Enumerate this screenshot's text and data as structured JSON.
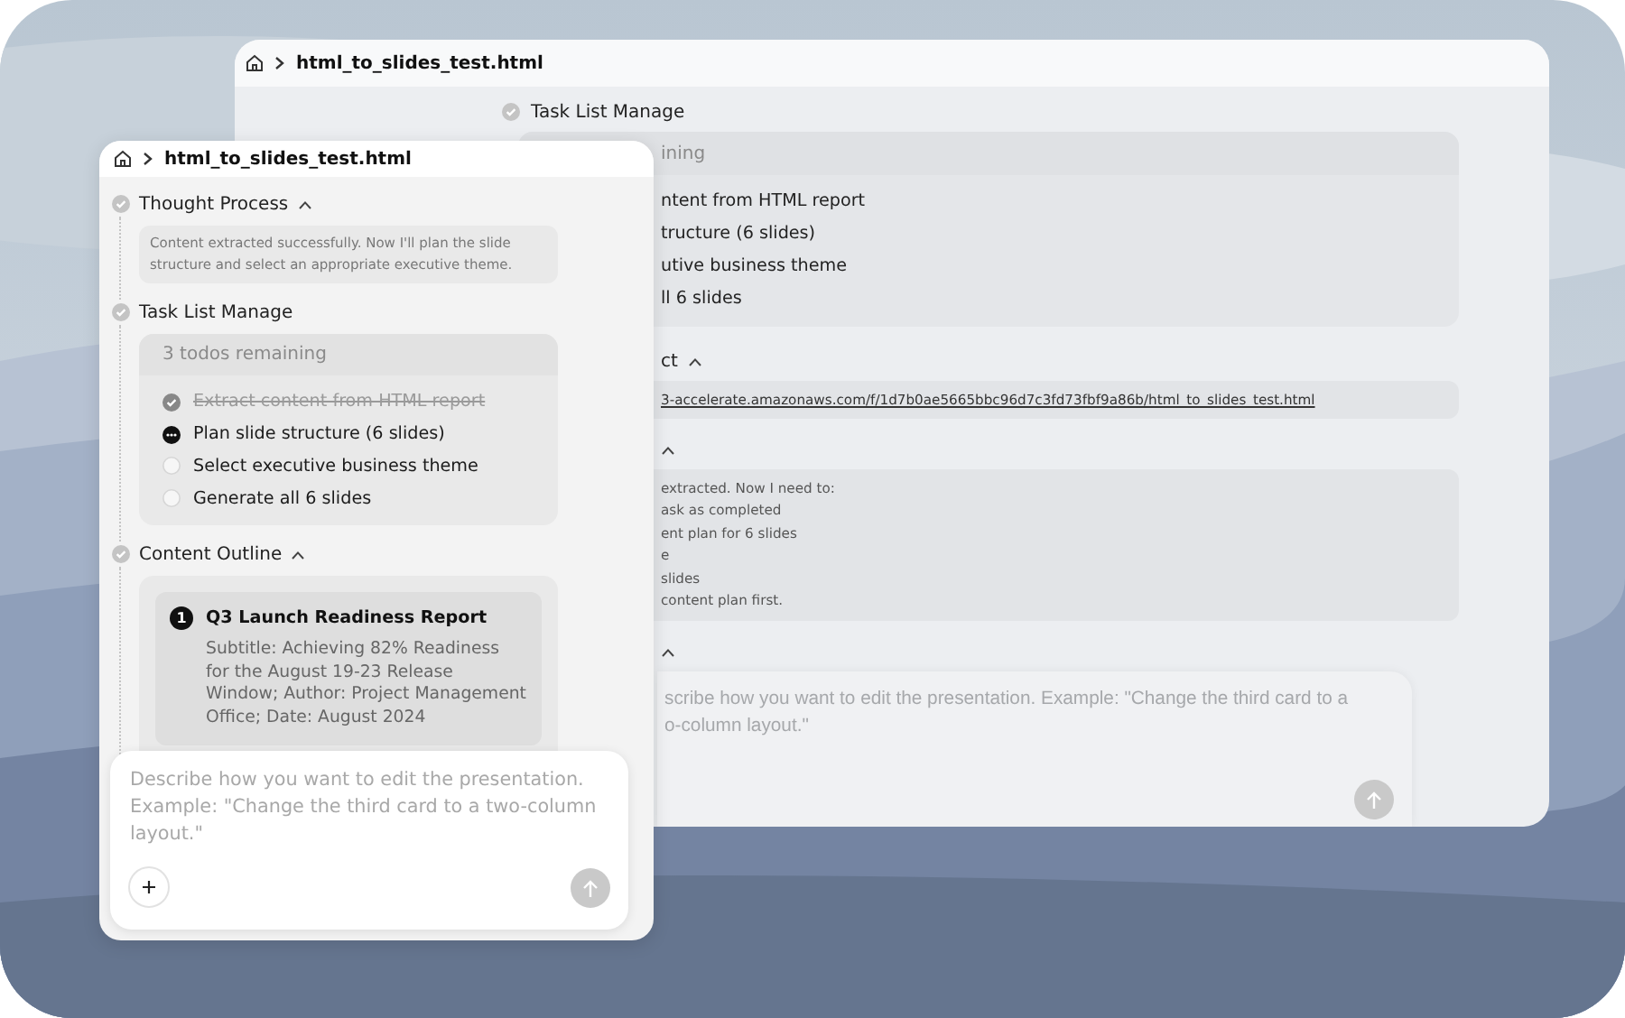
{
  "back_window": {
    "title": "html_to_slides_test.html",
    "sections": [
      {
        "kind": "todos",
        "heading": "Task List Manage",
        "header": "ining",
        "items": [
          "ntent from HTML report",
          "tructure (6 slides)",
          "utive business theme",
          "ll 6 slides"
        ]
      },
      {
        "kind": "link",
        "heading": "ct",
        "url": "3-accelerate.amazonaws.com/f/1d7b0ae5665bbc96d7c3fd73fbf9a86b/html_to_slides_test.html"
      },
      {
        "kind": "thought",
        "lines": [
          "extracted. Now I need to:",
          "ask as completed",
          "ent plan for 6 slides",
          "e",
          "slides",
          "content plan first."
        ]
      },
      {
        "kind": "collapsed"
      }
    ],
    "composer": {
      "placeholder": "scribe how you want to edit the presentation. Example: \"Change the third card to a\no-column layout.\""
    }
  },
  "front_panel": {
    "title": "html_to_slides_test.html",
    "sections": [
      {
        "kind": "thought",
        "heading": "Thought Process",
        "collapsible": true,
        "text": "Content extracted successfully. Now I'll plan the slide structure and select an appropriate executive theme."
      },
      {
        "kind": "todos",
        "heading": "Task List Manage",
        "collapsible": false,
        "header": "3 todos remaining",
        "items": [
          {
            "text": "Extract content from HTML report",
            "checked": true,
            "active": false
          },
          {
            "text": "Plan slide structure (6 slides)",
            "checked": false,
            "active": true
          },
          {
            "text": "Select executive business theme",
            "checked": false,
            "active": false
          },
          {
            "text": "Generate all 6 slides",
            "checked": false,
            "active": false
          }
        ]
      },
      {
        "kind": "outline",
        "heading": "Content Outline",
        "collapsible": true,
        "slides": [
          {
            "number": "1",
            "title": "Q3 Launch Readiness Report",
            "description": "Subtitle: Achieving 82% Readiness for the August 19-23 Release Window; Author: Project Management Office; Date: August 2024"
          }
        ]
      }
    ],
    "composer": {
      "placeholder": "Describe how you want to edit the presentation. Example: \"Change the third card to a two-column layout.\""
    }
  }
}
